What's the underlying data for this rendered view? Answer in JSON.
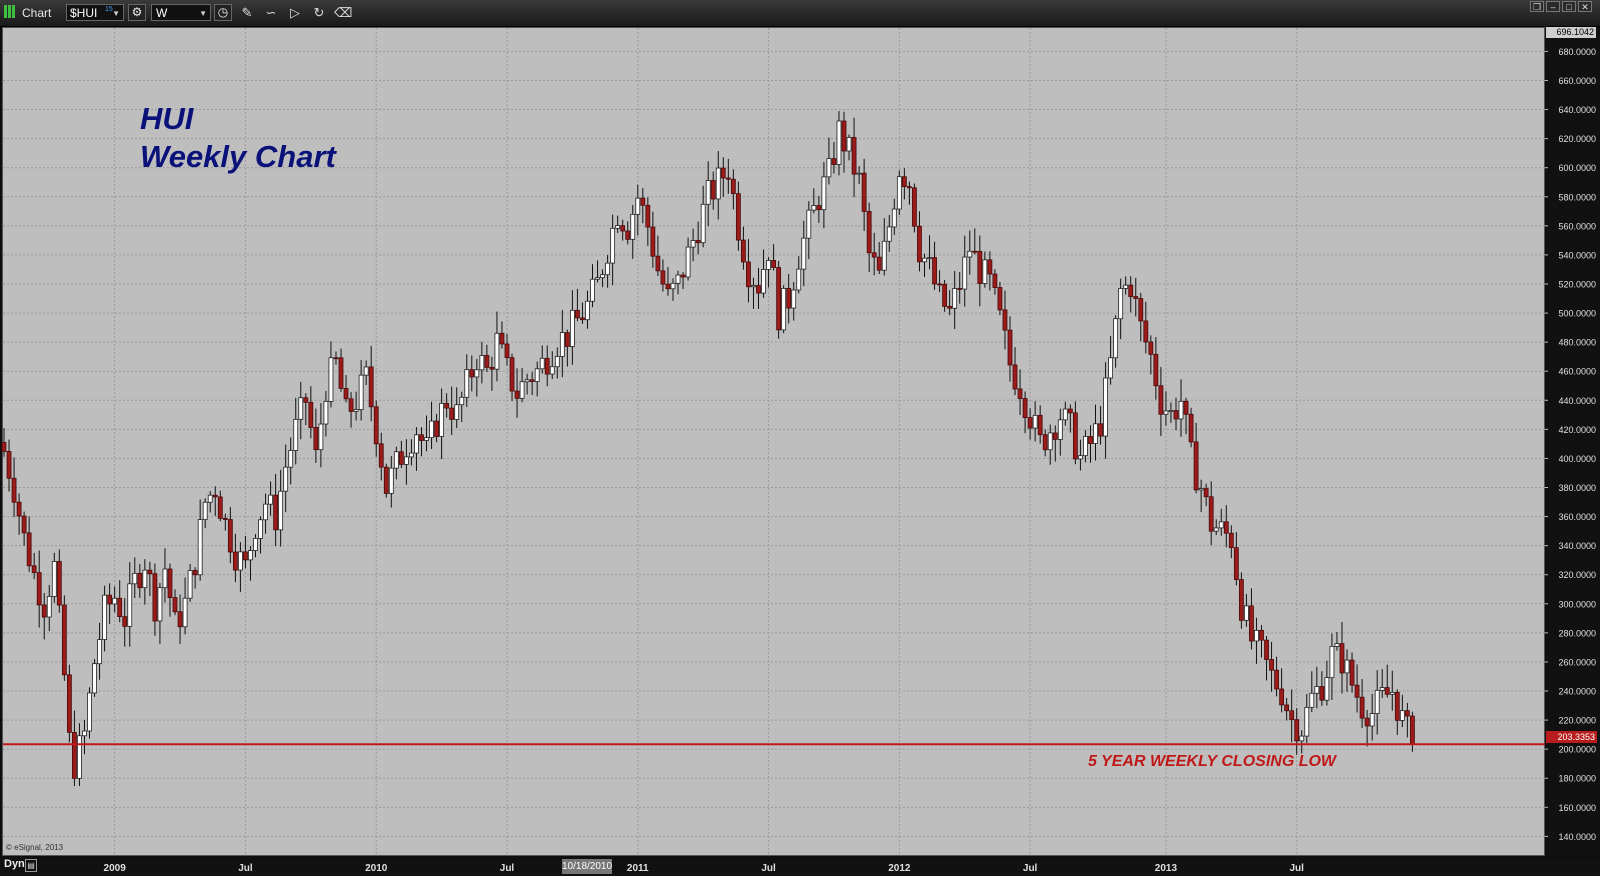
{
  "window": {
    "title": "Chart",
    "symbol": "$HUI",
    "symbol_superscript": "15",
    "interval": "W",
    "controls": [
      "restore-icon",
      "minimize-icon",
      "maximize-icon",
      "close-icon"
    ]
  },
  "toolbar": {
    "icons": [
      "settings-icon",
      "clock-icon",
      "pencil-icon",
      "curve-icon",
      "play-icon",
      "refresh-icon",
      "eraser-icon"
    ]
  },
  "annotations": {
    "title_line1": "HUI",
    "title_line2": "Weekly Chart",
    "support_label": "5 YEAR WEEKLY CLOSING LOW",
    "copyright": "© eSignal, 2013",
    "dyn_label": "Dyn",
    "cursor_date": "10/18/2010",
    "top_price_tag": "696.1042",
    "last_price_tag": "203.3353"
  },
  "colors": {
    "background": "#bebebe",
    "up_candle": "#ffffff",
    "down_candle": "#9b1b1b",
    "support_line": "#c01818",
    "title": "#0a127a"
  },
  "chart_data": {
    "type": "candlestick",
    "title": "HUI Weekly Chart",
    "symbol": "$HUI",
    "interval": "Weekly",
    "grid": true,
    "ylim": [
      126.5,
      696.1042
    ],
    "y_ticks": [
      "140.0000",
      "160.0000",
      "180.0000",
      "200.0000",
      "220.0000",
      "240.0000",
      "260.0000",
      "280.0000",
      "300.0000",
      "320.0000",
      "340.0000",
      "360.0000",
      "380.0000",
      "400.0000",
      "420.0000",
      "440.0000",
      "460.0000",
      "480.0000",
      "500.0000",
      "520.0000",
      "540.0000",
      "560.0000",
      "580.0000",
      "600.0000",
      "620.0000",
      "640.0000",
      "660.0000",
      "680.0000"
    ],
    "x_ticks": [
      {
        "label": "2009",
        "week": 22
      },
      {
        "label": "Jul",
        "week": 48
      },
      {
        "label": "2010",
        "week": 74
      },
      {
        "label": "Jul",
        "week": 100
      },
      {
        "label": "2011",
        "week": 126
      },
      {
        "label": "Jul",
        "week": 152
      },
      {
        "label": "2012",
        "week": 178
      },
      {
        "label": "Jul",
        "week": 204
      },
      {
        "label": "2013",
        "week": 231
      },
      {
        "label": "Jul",
        "week": 257
      }
    ],
    "support_level": {
      "value": 203.3353,
      "label": "5 YEAR WEEKLY CLOSING LOW"
    },
    "last_price": 203.3353,
    "high_marker": 696.1042,
    "close_path": [
      [
        0,
        405
      ],
      [
        2,
        380
      ],
      [
        4,
        345
      ],
      [
        6,
        320
      ],
      [
        8,
        300
      ],
      [
        10,
        325
      ],
      [
        12,
        250
      ],
      [
        13,
        205
      ],
      [
        14,
        190
      ],
      [
        16,
        210
      ],
      [
        18,
        260
      ],
      [
        20,
        295
      ],
      [
        22,
        305
      ],
      [
        24,
        290
      ],
      [
        26,
        315
      ],
      [
        28,
        330
      ],
      [
        30,
        300
      ],
      [
        32,
        325
      ],
      [
        34,
        285
      ],
      [
        36,
        300
      ],
      [
        38,
        330
      ],
      [
        40,
        370
      ],
      [
        42,
        380
      ],
      [
        44,
        355
      ],
      [
        46,
        335
      ],
      [
        48,
        325
      ],
      [
        50,
        355
      ],
      [
        52,
        370
      ],
      [
        54,
        360
      ],
      [
        56,
        395
      ],
      [
        58,
        420
      ],
      [
        60,
        440
      ],
      [
        62,
        400
      ],
      [
        64,
        450
      ],
      [
        66,
        465
      ],
      [
        68,
        430
      ],
      [
        70,
        440
      ],
      [
        72,
        455
      ],
      [
        74,
        420
      ],
      [
        76,
        380
      ],
      [
        78,
        395
      ],
      [
        80,
        410
      ],
      [
        82,
        420
      ],
      [
        84,
        405
      ],
      [
        86,
        425
      ],
      [
        88,
        440
      ],
      [
        90,
        430
      ],
      [
        92,
        450
      ],
      [
        94,
        470
      ],
      [
        96,
        460
      ],
      [
        98,
        480
      ],
      [
        100,
        460
      ],
      [
        102,
        445
      ],
      [
        104,
        455
      ],
      [
        106,
        460
      ],
      [
        108,
        470
      ],
      [
        110,
        480
      ],
      [
        112,
        485
      ],
      [
        114,
        495
      ],
      [
        116,
        505
      ],
      [
        118,
        520
      ],
      [
        120,
        545
      ],
      [
        122,
        570
      ],
      [
        124,
        560
      ],
      [
        126,
        580
      ],
      [
        128,
        560
      ],
      [
        130,
        530
      ],
      [
        132,
        510
      ],
      [
        134,
        520
      ],
      [
        136,
        540
      ],
      [
        138,
        560
      ],
      [
        140,
        580
      ],
      [
        142,
        590
      ],
      [
        144,
        600
      ],
      [
        146,
        560
      ],
      [
        148,
        530
      ],
      [
        150,
        520
      ],
      [
        152,
        545
      ],
      [
        154,
        500
      ],
      [
        156,
        510
      ],
      [
        158,
        540
      ],
      [
        160,
        560
      ],
      [
        162,
        580
      ],
      [
        164,
        595
      ],
      [
        166,
        625
      ],
      [
        168,
        610
      ],
      [
        170,
        590
      ],
      [
        172,
        540
      ],
      [
        174,
        525
      ],
      [
        176,
        560
      ],
      [
        178,
        600
      ],
      [
        180,
        590
      ],
      [
        182,
        545
      ],
      [
        184,
        530
      ],
      [
        186,
        510
      ],
      [
        188,
        500
      ],
      [
        190,
        520
      ],
      [
        192,
        545
      ],
      [
        194,
        530
      ],
      [
        196,
        520
      ],
      [
        198,
        495
      ],
      [
        200,
        465
      ],
      [
        202,
        450
      ],
      [
        204,
        430
      ],
      [
        206,
        410
      ],
      [
        208,
        420
      ],
      [
        210,
        430
      ],
      [
        212,
        420
      ],
      [
        214,
        400
      ],
      [
        216,
        410
      ],
      [
        218,
        425
      ],
      [
        220,
        465
      ],
      [
        222,
        515
      ],
      [
        224,
        520
      ],
      [
        226,
        490
      ],
      [
        228,
        470
      ],
      [
        230,
        440
      ],
      [
        232,
        430
      ],
      [
        234,
        440
      ],
      [
        236,
        400
      ],
      [
        238,
        380
      ],
      [
        240,
        355
      ],
      [
        242,
        350
      ],
      [
        244,
        345
      ],
      [
        246,
        300
      ],
      [
        248,
        275
      ],
      [
        250,
        265
      ],
      [
        252,
        250
      ],
      [
        254,
        240
      ],
      [
        256,
        220
      ],
      [
        258,
        215
      ],
      [
        260,
        235
      ],
      [
        262,
        245
      ],
      [
        264,
        265
      ],
      [
        266,
        262
      ],
      [
        268,
        245
      ],
      [
        270,
        230
      ],
      [
        272,
        225
      ],
      [
        274,
        235
      ],
      [
        276,
        240
      ],
      [
        278,
        220
      ],
      [
        280,
        203.34
      ]
    ]
  }
}
